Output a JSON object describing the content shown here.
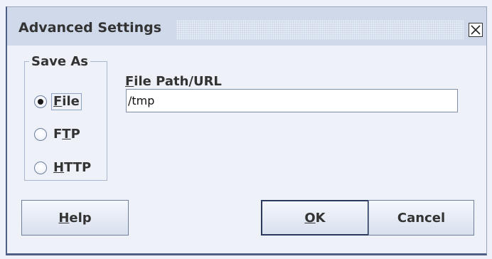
{
  "dialog": {
    "title": "Advanced Settings",
    "close_icon": "close-icon"
  },
  "save_as": {
    "legend": "Save As",
    "options": [
      {
        "pre": "",
        "mnemonic": "F",
        "post": "ile",
        "checked": true
      },
      {
        "pre": "F",
        "mnemonic": "T",
        "post": "P",
        "checked": false
      },
      {
        "pre": "",
        "mnemonic": "H",
        "post": "TTP",
        "checked": false
      }
    ]
  },
  "path": {
    "label_mnemonic": "F",
    "label_rest": "ile Path/URL",
    "value": "/tmp"
  },
  "buttons": {
    "help": {
      "mnemonic": "H",
      "rest": "elp"
    },
    "ok": {
      "mnemonic": "O",
      "rest": "K"
    },
    "cancel": "Cancel"
  }
}
